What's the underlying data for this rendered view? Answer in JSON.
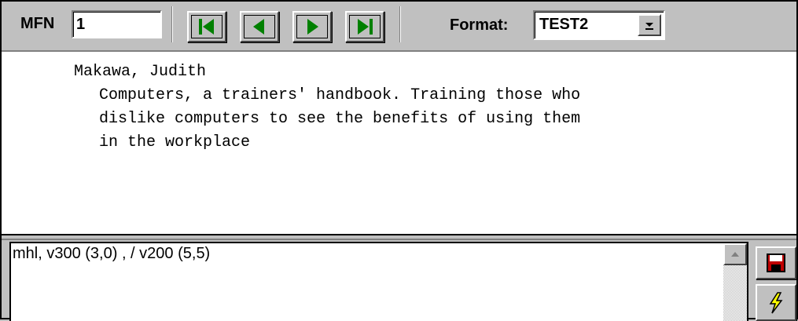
{
  "toolbar": {
    "mfn_label": "MFN",
    "mfn_value": "1",
    "nav": {
      "first_icon": "skip-first-icon",
      "prev_icon": "triangle-left-icon",
      "next_icon": "triangle-right-icon",
      "last_icon": "skip-last-icon",
      "icon_color": "#008000"
    },
    "format_label": "Format:",
    "format_value": "TEST2"
  },
  "display": {
    "lines": [
      "Makawa, Judith",
      "Computers, a trainers' handbook. Training those who",
      "dislike computers to see the benefits of using them",
      "in the workplace"
    ]
  },
  "editor": {
    "format_text": "mhl, v300 (3,0) , / v200 (5,5)"
  },
  "side_buttons": {
    "save_icon": "save-disk-icon",
    "run_icon": "lightning-icon",
    "save_color": "#c00000",
    "run_color": "#ffff00"
  }
}
